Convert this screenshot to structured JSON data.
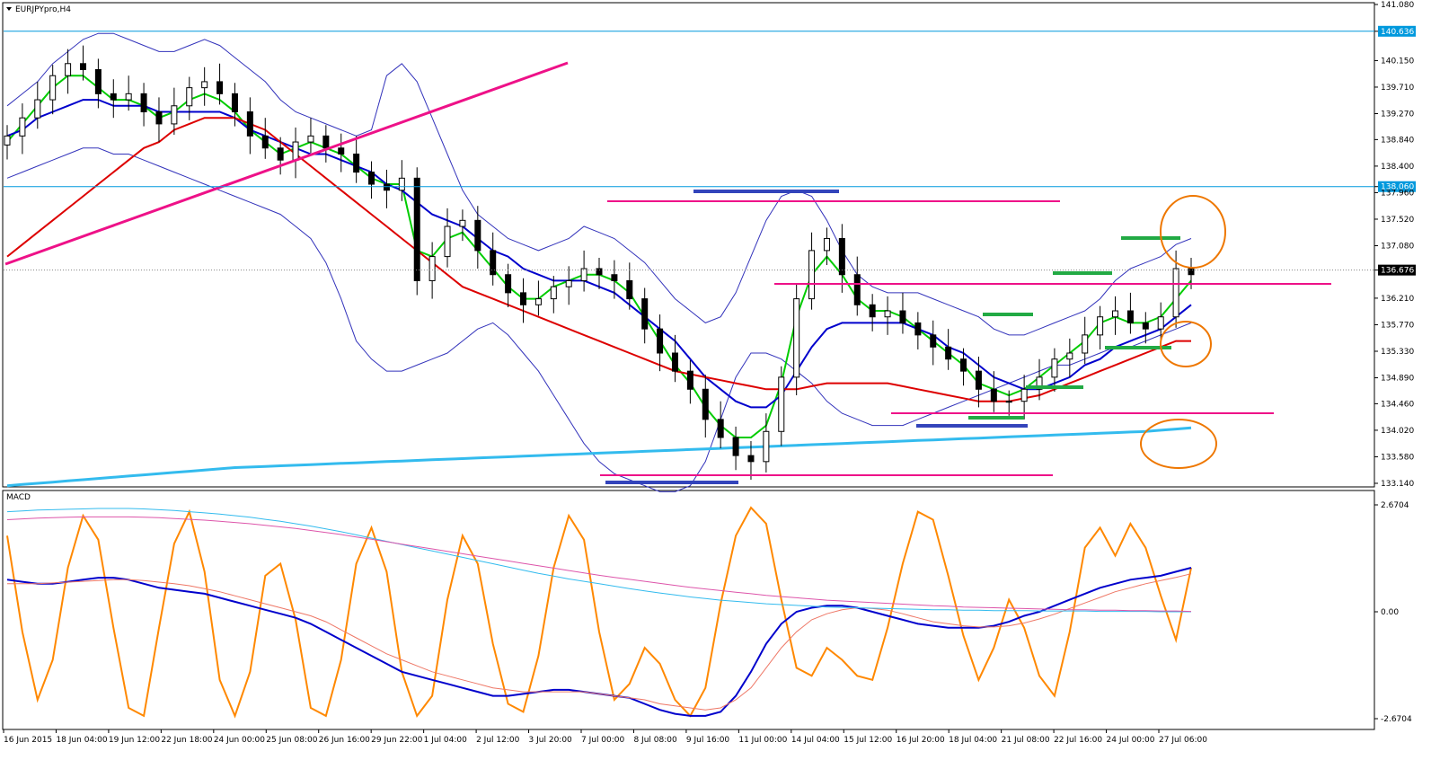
{
  "colors": {
    "background": "#ffffff",
    "bull_candle": "#ffffff",
    "bear_candle": "#000000",
    "ema_fast": "#00cc00",
    "ema_mid": "#0000cc",
    "ma_slow": "#dd0000",
    "ma_long": "#33bbee",
    "bands": "#3333bb",
    "annotation_magenta": "#ee1188",
    "annotation_blue": "#3344bb",
    "annotation_green": "#22aa44",
    "circles": "#ee7700",
    "hline": "#0099dd",
    "price_tag": "#000000",
    "level_tag": "#0099dd"
  },
  "chart_data": [
    {
      "type": "candlestick",
      "title": "EURJPYpro,H4",
      "symbol": "EURJPYpro",
      "timeframe": "H4",
      "current_price": "136.676",
      "ylim": [
        133.14,
        141.08
      ],
      "grid": false,
      "y_ticks": [
        "141.080",
        "140.636",
        "140.150",
        "139.710",
        "139.270",
        "138.840",
        "138.400",
        "138.060",
        "137.960",
        "137.520",
        "137.080",
        "136.676",
        "136.210",
        "135.770",
        "135.330",
        "134.890",
        "134.460",
        "134.020",
        "133.580",
        "133.140"
      ],
      "horizontal_levels": [
        {
          "value": 140.636,
          "label": "140.636"
        },
        {
          "value": 138.06,
          "label": "138.060"
        }
      ],
      "x_ticks": [
        "16 Jun 2015",
        "18 Jun 04:00",
        "19 Jun 12:00",
        "22 Jun 18:00",
        "24 Jun 00:00",
        "25 Jun 08:00",
        "26 Jun 16:00",
        "29 Jun 22:00",
        "1 Jul 04:00",
        "2 Jul 12:00",
        "3 Jul 20:00",
        "7 Jul 00:00",
        "8 Jul 08:00",
        "9 Jul 16:00",
        "11 Jul 00:00",
        "14 Jul 04:00",
        "15 Jul 12:00",
        "16 Jul 20:00",
        "18 Jul 04:00",
        "21 Jul 08:00",
        "22 Jul 16:00",
        "24 Jul 00:00",
        "27 Jul 06:00"
      ],
      "close_series": [
        138.9,
        139.2,
        139.5,
        139.9,
        140.1,
        140.0,
        139.6,
        139.5,
        139.6,
        139.3,
        139.1,
        139.4,
        139.7,
        139.8,
        139.6,
        139.3,
        138.9,
        138.7,
        138.5,
        138.8,
        138.9,
        138.7,
        138.6,
        138.3,
        138.1,
        138.0,
        138.2,
        136.5,
        136.9,
        137.4,
        137.5,
        137.0,
        136.6,
        136.3,
        136.1,
        136.2,
        136.4,
        136.5,
        136.7,
        136.6,
        136.5,
        136.2,
        135.7,
        135.3,
        135.0,
        134.7,
        134.2,
        133.9,
        133.6,
        133.5,
        134.0,
        134.9,
        136.2,
        137.0,
        137.2,
        136.6,
        136.1,
        135.9,
        136.0,
        135.8,
        135.6,
        135.4,
        135.2,
        135.0,
        134.7,
        134.5,
        134.5,
        134.7,
        134.9,
        135.2,
        135.3,
        135.6,
        135.9,
        136.0,
        135.8,
        135.7,
        135.9,
        136.7,
        136.6
      ],
      "series": [
        {
          "name": "",
          "color": "#00cc00",
          "values": [
            138.8,
            139.1,
            139.4,
            139.7,
            139.9,
            139.9,
            139.7,
            139.5,
            139.5,
            139.4,
            139.2,
            139.3,
            139.5,
            139.6,
            139.5,
            139.3,
            139.0,
            138.8,
            138.6,
            138.7,
            138.8,
            138.7,
            138.6,
            138.4,
            138.2,
            138.1,
            138.1,
            137.0,
            136.9,
            137.2,
            137.3,
            137.0,
            136.7,
            136.4,
            136.2,
            136.2,
            136.4,
            136.5,
            136.6,
            136.6,
            136.5,
            136.3,
            135.9,
            135.5,
            135.1,
            134.8,
            134.4,
            134.1,
            133.9,
            133.9,
            134.1,
            134.8,
            135.9,
            136.6,
            136.9,
            136.6,
            136.2,
            136.0,
            136.0,
            135.9,
            135.7,
            135.5,
            135.3,
            135.1,
            134.8,
            134.7,
            134.6,
            134.7,
            134.9,
            135.1,
            135.3,
            135.5,
            135.8,
            135.9,
            135.8,
            135.8,
            135.9,
            136.2,
            136.5
          ]
        },
        {
          "name": "",
          "color": "#0000cc",
          "values": [
            138.9,
            139.0,
            139.2,
            139.3,
            139.4,
            139.5,
            139.5,
            139.4,
            139.4,
            139.4,
            139.3,
            139.3,
            139.3,
            139.3,
            139.3,
            139.2,
            139.0,
            138.9,
            138.8,
            138.7,
            138.6,
            138.6,
            138.5,
            138.4,
            138.3,
            138.1,
            138.0,
            137.8,
            137.6,
            137.5,
            137.4,
            137.2,
            137.0,
            136.9,
            136.7,
            136.6,
            136.5,
            136.5,
            136.5,
            136.4,
            136.3,
            136.1,
            135.9,
            135.7,
            135.5,
            135.2,
            134.9,
            134.7,
            134.5,
            134.4,
            134.4,
            134.6,
            135.0,
            135.4,
            135.7,
            135.8,
            135.8,
            135.8,
            135.8,
            135.8,
            135.7,
            135.6,
            135.4,
            135.3,
            135.1,
            134.9,
            134.8,
            134.7,
            134.7,
            134.8,
            134.9,
            135.1,
            135.2,
            135.4,
            135.5,
            135.6,
            135.7,
            135.9,
            136.1
          ]
        },
        {
          "name": "",
          "color": "#dd0000",
          "values": [
            136.9,
            137.1,
            137.3,
            137.5,
            137.7,
            137.9,
            138.1,
            138.3,
            138.5,
            138.7,
            138.8,
            139.0,
            139.1,
            139.2,
            139.2,
            139.2,
            139.1,
            139.0,
            138.8,
            138.6,
            138.4,
            138.2,
            138.0,
            137.8,
            137.6,
            137.4,
            137.2,
            137.0,
            136.8,
            136.6,
            136.4,
            136.3,
            136.2,
            136.1,
            136.0,
            135.9,
            135.8,
            135.7,
            135.6,
            135.5,
            135.4,
            135.3,
            135.2,
            135.1,
            135.0,
            134.95,
            134.9,
            134.85,
            134.8,
            134.75,
            134.7,
            134.7,
            134.7,
            134.75,
            134.8,
            134.8,
            134.8,
            134.8,
            134.8,
            134.75,
            134.7,
            134.65,
            134.6,
            134.55,
            134.5,
            134.5,
            134.5,
            134.55,
            134.6,
            134.7,
            134.8,
            134.9,
            135.0,
            135.1,
            135.2,
            135.3,
            135.4,
            135.5,
            135.5
          ]
        },
        {
          "name": "",
          "color": "#33bbee",
          "values": [
            133.1,
            133.12,
            133.14,
            133.16,
            133.18,
            133.2,
            133.22,
            133.24,
            133.26,
            133.28,
            133.3,
            133.32,
            133.34,
            133.36,
            133.38,
            133.4,
            133.41,
            133.42,
            133.43,
            133.44,
            133.45,
            133.46,
            133.47,
            133.48,
            133.49,
            133.5,
            133.51,
            133.52,
            133.53,
            133.54,
            133.55,
            133.56,
            133.57,
            133.58,
            133.59,
            133.6,
            133.61,
            133.62,
            133.63,
            133.64,
            133.65,
            133.66,
            133.67,
            133.68,
            133.69,
            133.7,
            133.71,
            133.72,
            133.73,
            133.74,
            133.75,
            133.76,
            133.77,
            133.78,
            133.79,
            133.8,
            133.81,
            133.82,
            133.83,
            133.84,
            133.85,
            133.86,
            133.87,
            133.88,
            133.89,
            133.9,
            133.91,
            133.92,
            133.93,
            133.94,
            133.95,
            133.96,
            133.97,
            133.98,
            133.99,
            134.0,
            134.02,
            134.04,
            134.06
          ]
        }
      ],
      "band_upper": [
        139.4,
        139.6,
        139.8,
        140.1,
        140.3,
        140.5,
        140.6,
        140.6,
        140.5,
        140.4,
        140.3,
        140.3,
        140.4,
        140.5,
        140.4,
        140.2,
        140.0,
        139.8,
        139.5,
        139.3,
        139.2,
        139.1,
        139.0,
        138.9,
        139.0,
        139.9,
        140.1,
        139.8,
        139.2,
        138.6,
        138.0,
        137.6,
        137.4,
        137.2,
        137.1,
        137.0,
        137.1,
        137.2,
        137.4,
        137.3,
        137.2,
        137.0,
        136.8,
        136.5,
        136.2,
        136.0,
        135.8,
        135.9,
        136.3,
        136.9,
        137.5,
        137.9,
        138.0,
        137.9,
        137.5,
        137.0,
        136.6,
        136.4,
        136.3,
        136.3,
        136.3,
        136.2,
        136.1,
        136.0,
        135.9,
        135.7,
        135.6,
        135.6,
        135.7,
        135.8,
        135.9,
        136.0,
        136.2,
        136.5,
        136.7,
        136.8,
        136.9,
        137.1,
        137.2
      ],
      "band_lower": [
        138.2,
        138.3,
        138.4,
        138.5,
        138.6,
        138.7,
        138.7,
        138.6,
        138.6,
        138.5,
        138.4,
        138.3,
        138.2,
        138.1,
        138.0,
        137.9,
        137.8,
        137.7,
        137.6,
        137.4,
        137.2,
        136.8,
        136.2,
        135.5,
        135.2,
        135.0,
        135.0,
        135.1,
        135.2,
        135.3,
        135.5,
        135.7,
        135.8,
        135.6,
        135.3,
        135.0,
        134.6,
        134.2,
        133.8,
        133.5,
        133.3,
        133.2,
        133.1,
        133.0,
        133.0,
        133.1,
        133.5,
        134.2,
        134.9,
        135.3,
        135.3,
        135.2,
        135.0,
        134.8,
        134.5,
        134.3,
        134.2,
        134.1,
        134.1,
        134.1,
        134.2,
        134.3,
        134.4,
        134.5,
        134.6,
        134.7,
        134.8,
        134.9,
        135.0,
        135.1,
        135.1,
        135.2,
        135.3,
        135.4,
        135.4,
        135.5,
        135.6,
        135.7,
        135.8
      ]
    },
    {
      "type": "line",
      "title": "MACD",
      "ylim": [
        -2.6704,
        2.6704
      ],
      "y_ticks": [
        "2.6704",
        "0.00",
        "-2.6704"
      ],
      "series": [
        {
          "name": "",
          "color": "#ff8800",
          "values": [
            1.9,
            -0.5,
            -2.2,
            -1.2,
            1.1,
            2.4,
            1.8,
            -0.4,
            -2.4,
            -2.6,
            -0.4,
            1.7,
            2.5,
            1.0,
            -1.7,
            -2.6,
            -1.5,
            0.9,
            1.2,
            -0.2,
            -2.4,
            -2.6,
            -1.2,
            1.2,
            2.1,
            1.0,
            -1.5,
            -2.6,
            -2.1,
            0.3,
            1.9,
            1.2,
            -0.8,
            -2.3,
            -2.5,
            -1.1,
            1.1,
            2.4,
            1.8,
            -0.5,
            -2.2,
            -1.8,
            -0.9,
            -1.3,
            -2.2,
            -2.6,
            -1.9,
            0.2,
            1.9,
            2.6,
            2.2,
            0.3,
            -1.4,
            -1.6,
            -0.9,
            -1.2,
            -1.6,
            -1.7,
            -0.4,
            1.2,
            2.5,
            2.3,
            0.9,
            -0.6,
            -1.7,
            -0.9,
            0.3,
            -0.4,
            -1.6,
            -2.1,
            -0.5,
            1.6,
            2.1,
            1.4,
            2.2,
            1.6,
            0.4,
            -0.7,
            1.1
          ]
        },
        {
          "name": "",
          "color": "#0000cc",
          "values": [
            0.8,
            0.75,
            0.7,
            0.7,
            0.75,
            0.8,
            0.85,
            0.85,
            0.8,
            0.7,
            0.6,
            0.55,
            0.5,
            0.45,
            0.35,
            0.25,
            0.15,
            0.05,
            -0.05,
            -0.15,
            -0.3,
            -0.5,
            -0.7,
            -0.9,
            -1.1,
            -1.3,
            -1.5,
            -1.6,
            -1.7,
            -1.8,
            -1.9,
            -2.0,
            -2.1,
            -2.1,
            -2.05,
            -2.0,
            -1.95,
            -1.95,
            -2.0,
            -2.05,
            -2.1,
            -2.15,
            -2.3,
            -2.45,
            -2.55,
            -2.6,
            -2.6,
            -2.5,
            -2.1,
            -1.5,
            -0.8,
            -0.3,
            0.0,
            0.1,
            0.15,
            0.15,
            0.1,
            0.0,
            -0.1,
            -0.2,
            -0.3,
            -0.35,
            -0.4,
            -0.4,
            -0.4,
            -0.35,
            -0.25,
            -0.1,
            0.0,
            0.15,
            0.3,
            0.45,
            0.6,
            0.7,
            0.8,
            0.85,
            0.9,
            1.0,
            1.1
          ]
        },
        {
          "name": "",
          "color": "#ee7766",
          "values": [
            0.7,
            0.7,
            0.7,
            0.72,
            0.74,
            0.76,
            0.78,
            0.8,
            0.8,
            0.78,
            0.74,
            0.7,
            0.65,
            0.58,
            0.5,
            0.4,
            0.3,
            0.2,
            0.1,
            0.0,
            -0.1,
            -0.25,
            -0.45,
            -0.65,
            -0.85,
            -1.05,
            -1.2,
            -1.35,
            -1.5,
            -1.6,
            -1.7,
            -1.8,
            -1.9,
            -1.95,
            -2.0,
            -2.0,
            -2.0,
            -2.0,
            -2.0,
            -2.05,
            -2.1,
            -2.15,
            -2.2,
            -2.3,
            -2.35,
            -2.4,
            -2.45,
            -2.4,
            -2.2,
            -1.9,
            -1.4,
            -0.9,
            -0.5,
            -0.2,
            -0.05,
            0.05,
            0.1,
            0.08,
            0.04,
            -0.05,
            -0.15,
            -0.25,
            -0.3,
            -0.35,
            -0.38,
            -0.38,
            -0.35,
            -0.28,
            -0.18,
            -0.06,
            0.08,
            0.22,
            0.36,
            0.5,
            0.6,
            0.7,
            0.78,
            0.86,
            0.95
          ]
        },
        {
          "name": "",
          "color": "#33bbee",
          "values": [
            2.5,
            2.52,
            2.54,
            2.55,
            2.56,
            2.57,
            2.58,
            2.58,
            2.58,
            2.57,
            2.55,
            2.53,
            2.5,
            2.47,
            2.44,
            2.4,
            2.36,
            2.31,
            2.26,
            2.2,
            2.14,
            2.07,
            2.0,
            1.92,
            1.84,
            1.76,
            1.68,
            1.6,
            1.52,
            1.44,
            1.36,
            1.28,
            1.2,
            1.12,
            1.04,
            0.96,
            0.89,
            0.82,
            0.76,
            0.7,
            0.64,
            0.58,
            0.52,
            0.47,
            0.42,
            0.37,
            0.33,
            0.29,
            0.26,
            0.23,
            0.2,
            0.18,
            0.16,
            0.14,
            0.12,
            0.11,
            0.1,
            0.09,
            0.08,
            0.07,
            0.06,
            0.05,
            0.05,
            0.04,
            0.04,
            0.03,
            0.03,
            0.03,
            0.02,
            0.02,
            0.02,
            0.02,
            0.01,
            0.01,
            0.01,
            0.01,
            0.0,
            0.0,
            0.0
          ]
        },
        {
          "name": "",
          "color": "#dd55aa",
          "values": [
            2.3,
            2.32,
            2.34,
            2.35,
            2.36,
            2.37,
            2.37,
            2.37,
            2.37,
            2.36,
            2.35,
            2.33,
            2.31,
            2.29,
            2.26,
            2.23,
            2.2,
            2.16,
            2.12,
            2.08,
            2.03,
            1.98,
            1.93,
            1.87,
            1.81,
            1.75,
            1.69,
            1.63,
            1.57,
            1.51,
            1.45,
            1.39,
            1.33,
            1.27,
            1.21,
            1.15,
            1.09,
            1.03,
            0.97,
            0.91,
            0.86,
            0.81,
            0.76,
            0.71,
            0.66,
            0.61,
            0.57,
            0.53,
            0.49,
            0.45,
            0.41,
            0.38,
            0.35,
            0.32,
            0.29,
            0.27,
            0.25,
            0.23,
            0.21,
            0.19,
            0.17,
            0.15,
            0.14,
            0.12,
            0.11,
            0.1,
            0.09,
            0.08,
            0.07,
            0.06,
            0.05,
            0.05,
            0.04,
            0.04,
            0.03,
            0.03,
            0.02,
            0.02,
            0.01
          ]
        }
      ]
    }
  ]
}
